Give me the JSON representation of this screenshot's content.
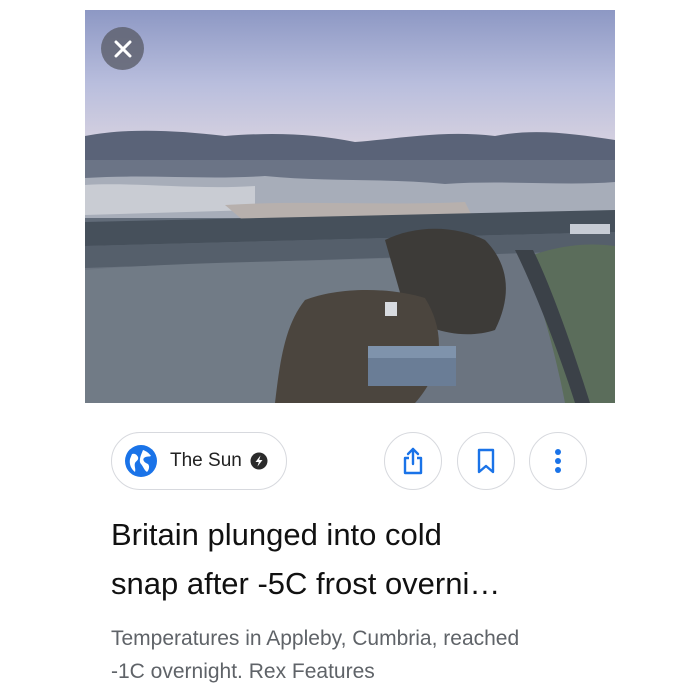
{
  "article": {
    "source": {
      "name": "The Sun",
      "icon": "globe-icon",
      "badge_icon": "amp-bolt-icon"
    },
    "actions": [
      {
        "name": "share",
        "icon": "share-icon"
      },
      {
        "name": "save",
        "icon": "bookmark-icon"
      },
      {
        "name": "more",
        "icon": "more-vert-icon"
      }
    ],
    "close_icon": "close-icon",
    "headline_lines": [
      "Britain plunged into cold",
      "snap after -5C frost overni…"
    ],
    "caption_lines": [
      "Temperatures in Appleby, Cumbria, reached",
      "-1C overnight. Rex Features"
    ]
  },
  "colors": {
    "accent": "#1a73e8",
    "chip_border": "#d7d9de",
    "caption_text": "#5f6368"
  }
}
